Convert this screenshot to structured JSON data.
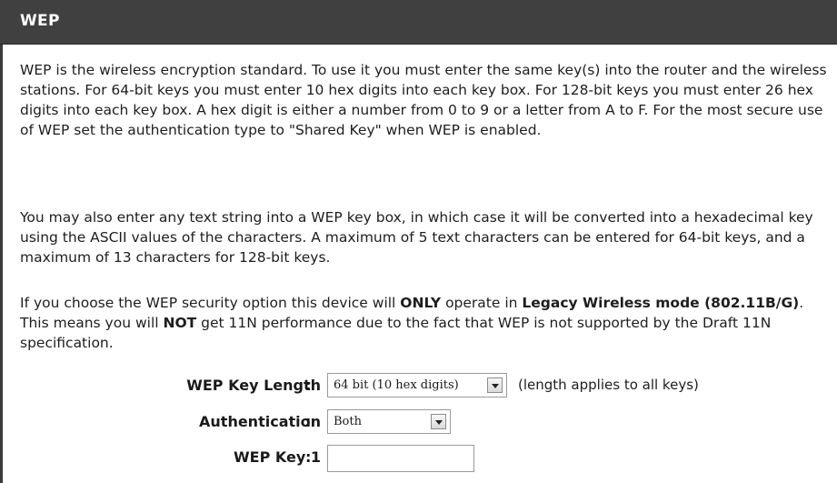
{
  "header": {
    "title": "WEP"
  },
  "paragraphs": {
    "p1": "WEP is the wireless encryption standard. To use it you must enter the same key(s) into the router and the wireless stations. For 64-bit keys you must enter 10 hex digits into each key box. For 128-bit keys you must enter 26 hex digits into each key box. A hex digit is either a number from 0 to 9 or a letter from A to F. For the most secure use of WEP set the authentication type to \"Shared Key\" when WEP is enabled.",
    "p2": "You may also enter any text string into a WEP key box, in which case it will be converted into a hexadecimal key using the ASCII values of the characters. A maximum of 5 text characters can be entered for 64-bit keys, and a maximum of 13 characters for 128-bit keys.",
    "p3": {
      "seg1": "If you choose the WEP security option this device will ",
      "bold1": "ONLY",
      "seg2": " operate in ",
      "bold2": "Legacy Wireless mode (802.11B/G)",
      "seg3": ". This means you will ",
      "bold3": "NOT",
      "seg4": " get 11N performance due to the fact that WEP is not supported by the Draft 11N specification."
    }
  },
  "form": {
    "key_length": {
      "label": "WEP Key Length",
      "colon": ":",
      "selected": "64 bit (10 hex digits)",
      "hint": "(length applies to all keys)"
    },
    "authentication": {
      "label": "Authentication",
      "colon": ":",
      "selected": "Both"
    },
    "key1": {
      "label": "WEP Key 1",
      "colon": ":",
      "value": ""
    }
  },
  "icons": {
    "dropdown": "chevron-down-icon"
  }
}
